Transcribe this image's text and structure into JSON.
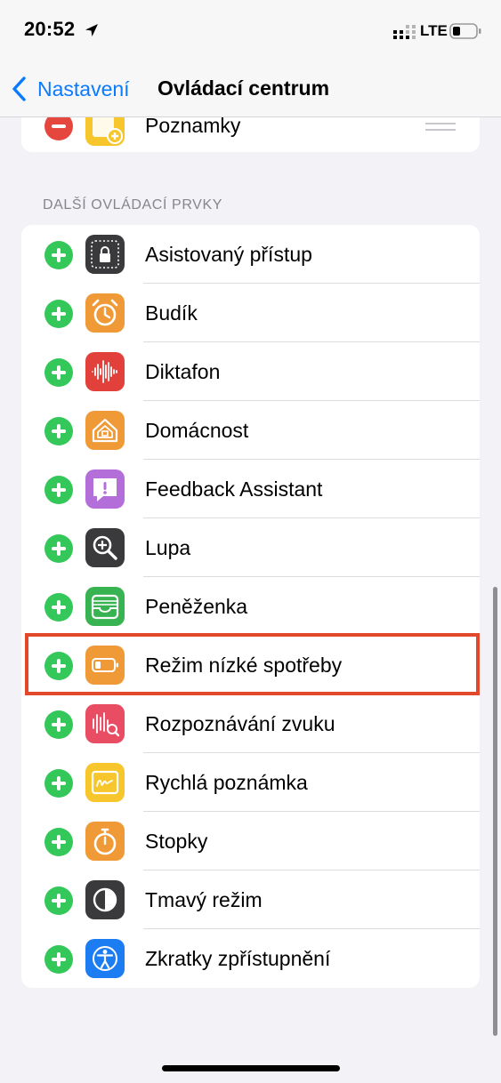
{
  "status": {
    "time": "20:52",
    "network": "LTE"
  },
  "nav": {
    "back_label": "Nastavení",
    "title": "Ovládací centrum"
  },
  "included": {
    "items": [
      {
        "label": "Poznamky",
        "icon": "notes-icon"
      }
    ]
  },
  "more": {
    "header": "DALŠÍ OVLÁDACÍ PRVKY",
    "items": [
      {
        "label": "Asistovaný přístup",
        "icon": "guided-access-icon",
        "color": "#3a3a3c"
      },
      {
        "label": "Budík",
        "icon": "alarm-clock-icon",
        "color": "#f09a37"
      },
      {
        "label": "Diktafon",
        "icon": "voice-memos-icon",
        "color": "#e2403a"
      },
      {
        "label": "Domácnost",
        "icon": "home-icon",
        "color": "#f09a37"
      },
      {
        "label": "Feedback Assistant",
        "icon": "feedback-icon",
        "color": "#b46ed9"
      },
      {
        "label": "Lupa",
        "icon": "magnifier-icon",
        "color": "#3a3a3c"
      },
      {
        "label": "Peněženka",
        "icon": "wallet-icon",
        "color": "#38b351"
      },
      {
        "label": "Režim nízké spotřeby",
        "icon": "low-power-icon",
        "color": "#f09a37"
      },
      {
        "label": "Rozpoznávání zvuku",
        "icon": "sound-recognition-icon",
        "color": "#e94d63"
      },
      {
        "label": "Rychlá poznámka",
        "icon": "quick-note-icon",
        "color": "#f7c62c"
      },
      {
        "label": "Stopky",
        "icon": "stopwatch-icon",
        "color": "#f09a37"
      },
      {
        "label": "Tmavý režim",
        "icon": "dark-mode-icon",
        "color": "#3a3a3c"
      },
      {
        "label": "Zkratky zpřístupnění",
        "icon": "accessibility-icon",
        "color": "#1c7cf2"
      }
    ]
  },
  "highlighted_item": "Režim nízké spotřeby"
}
